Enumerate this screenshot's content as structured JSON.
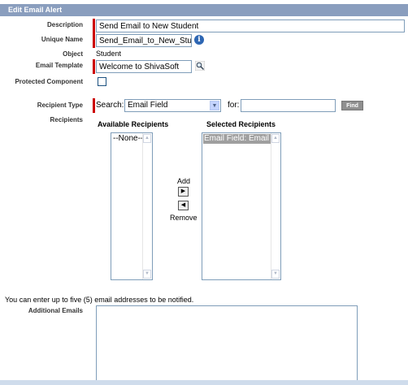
{
  "section_title": "Edit Email Alert",
  "fields": {
    "description": {
      "label": "Description",
      "value": "Send Email to New Student"
    },
    "unique_name": {
      "label": "Unique Name",
      "value": "Send_Email_to_New_Stud"
    },
    "object": {
      "label": "Object",
      "value": "Student"
    },
    "email_template": {
      "label": "Email Template",
      "value": "Welcome to ShivaSoft"
    },
    "protected_component": {
      "label": "Protected Component",
      "checked": false
    }
  },
  "recipient_type": {
    "label": "Recipient Type",
    "search_label": "Search:",
    "search_value": "Email Field",
    "for_label": "for:",
    "for_value": "",
    "find_label": "Find"
  },
  "recipients": {
    "label": "Recipients",
    "available_header": "Available Recipients",
    "selected_header": "Selected Recipients",
    "available_items": [
      "--None--"
    ],
    "selected_items": [
      "Email Field: Email"
    ],
    "add_label": "Add",
    "remove_label": "Remove"
  },
  "additional": {
    "note": "You can enter up to five (5) email addresses to be notified.",
    "label": "Additional Emails",
    "value": ""
  },
  "icons": {
    "info": "info-icon",
    "lookup": "lookup-magnifier-icon",
    "add_arrow": "arrow-right-icon",
    "remove_arrow": "arrow-left-icon"
  },
  "colors": {
    "header_bg": "#8a9ebe",
    "required_bar": "#cc0000",
    "selected_item_bg": "#9f9f9f"
  }
}
